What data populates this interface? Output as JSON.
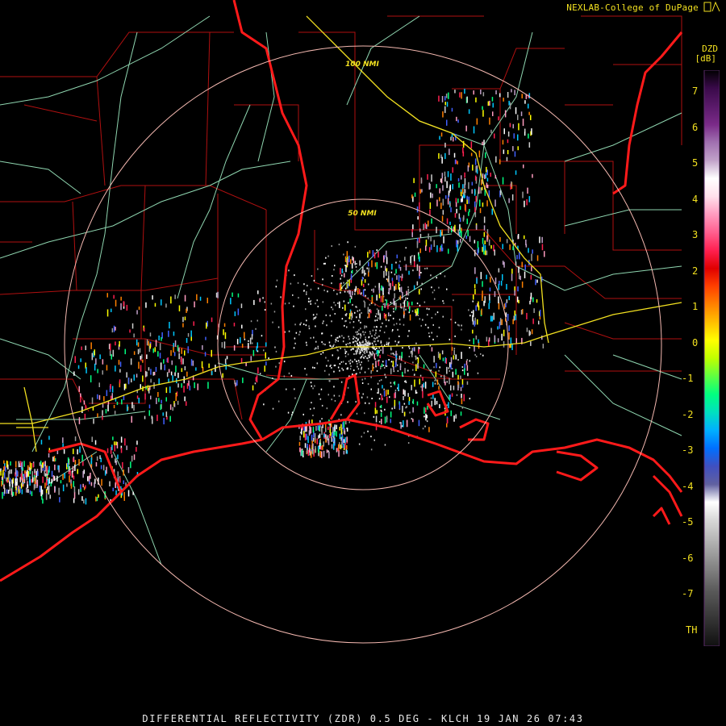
{
  "credit": "NEXLAB-College of DuPage",
  "legend": {
    "product": "DZD",
    "unit": "[dB]",
    "ticks": [
      "7",
      "6",
      "5",
      "4",
      "3",
      "2",
      "1",
      "0",
      "-1",
      "-2",
      "-3",
      "-4",
      "-5",
      "-6",
      "-7",
      "TH"
    ],
    "gradient": [
      "#000000",
      "#3a0a4a",
      "#5a1a6a",
      "#7a2a88",
      "#a070b0",
      "#c0a0c8",
      "#ffffff",
      "#ffe0ec",
      "#ff9cc0",
      "#ff6090",
      "#ff2050",
      "#e00000",
      "#ff4000",
      "#ff8000",
      "#ffc000",
      "#ffff00",
      "#c0ff00",
      "#60ff40",
      "#00ff80",
      "#00e0c0",
      "#00b0ff",
      "#0070ff",
      "#4050c0",
      "#6060a0",
      "#ffffff",
      "#d8d8d8",
      "#b8b8b8",
      "#989898",
      "#787878",
      "#585858",
      "#404040",
      "#282828",
      "#101010"
    ]
  },
  "rings": {
    "inner_label": "50 NMI",
    "outer_label": "100 NMI"
  },
  "colors": {
    "coast": "#ff1a1a",
    "county": "#b01010",
    "highway": "#f2e020",
    "road": "#8fd6b0",
    "ring": "#f4b8b0"
  },
  "title": "DIFFERENTIAL REFLECTIVITY (ZDR) 0.5 DEG - KLCH 19 JAN 26 07:43"
}
